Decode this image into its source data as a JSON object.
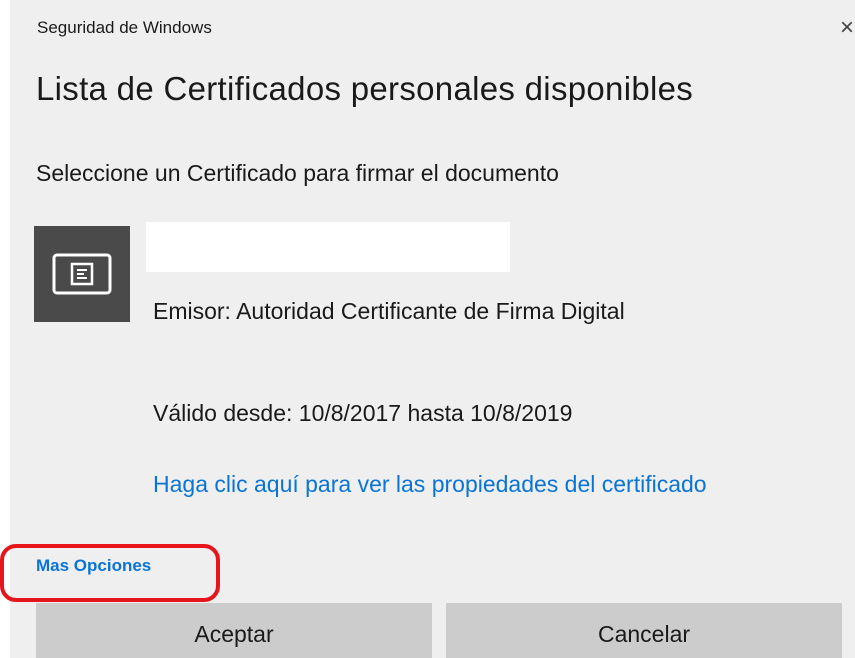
{
  "window": {
    "title": "Seguridad de Windows",
    "close_glyph": "×"
  },
  "dialog": {
    "heading": "Lista de Certificados personales disponibles",
    "instruction": "Seleccione un Certificado para firmar el documento"
  },
  "certificate": {
    "icon": "certificate-icon",
    "name": "",
    "issuer": "Emisor: Autoridad Certificante de Firma Digital",
    "validity": "Válido desde: 10/8/2017 hasta 10/8/2019",
    "properties_link": "Haga clic aquí para ver las propiedades del certificado"
  },
  "more_options": {
    "label": "Mas Opciones"
  },
  "buttons": {
    "accept": "Aceptar",
    "cancel": "Cancelar"
  },
  "colors": {
    "link": "#0a74d6",
    "highlight": "#e8141c",
    "dialog_bg": "#efefef",
    "tile_bg": "#4a4a4a",
    "button_bg": "#cccccc"
  }
}
